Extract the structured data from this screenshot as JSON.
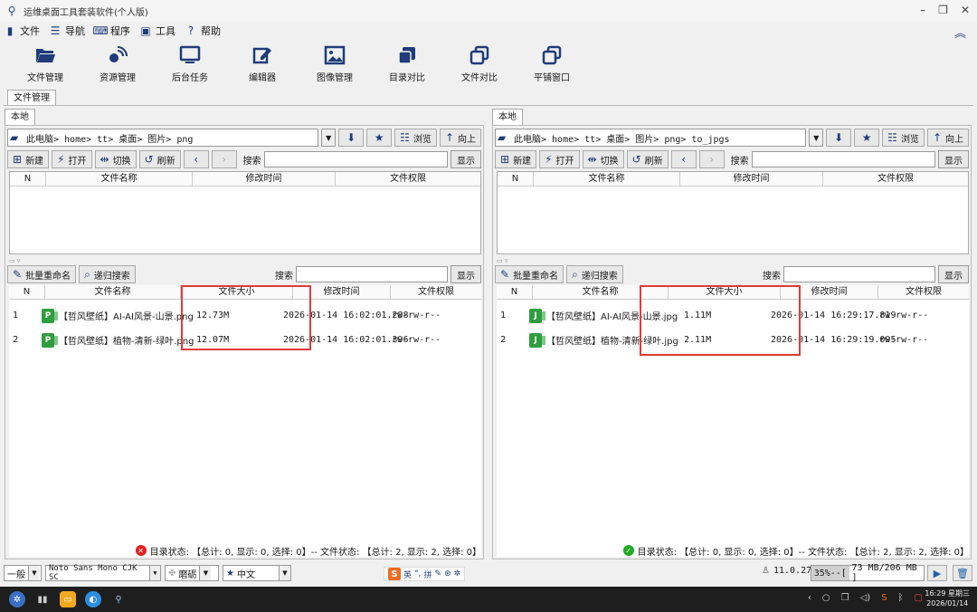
{
  "window": {
    "title": "运维桌面工具套装软件(个人版)"
  },
  "menu": [
    {
      "label": "文件",
      "icon": "file-icon"
    },
    {
      "label": "导航",
      "icon": "list-icon"
    },
    {
      "label": "程序",
      "icon": "keyboard-icon"
    },
    {
      "label": "工具",
      "icon": "toolbox-icon"
    },
    {
      "label": "帮助",
      "icon": "help-icon"
    }
  ],
  "toolbar": [
    {
      "label": "文件管理",
      "icon": "folder-open-icon"
    },
    {
      "label": "资源管理",
      "icon": "satellite-icon"
    },
    {
      "label": "后台任务",
      "icon": "monitor-icon"
    },
    {
      "label": "编辑器",
      "icon": "edit-icon"
    },
    {
      "label": "图像管理",
      "icon": "image-icon"
    },
    {
      "label": "目录对比",
      "icon": "copy-icon"
    },
    {
      "label": "文件对比",
      "icon": "compare-icon"
    },
    {
      "label": "平铺窗口",
      "icon": "windows-icon"
    }
  ],
  "main_tab": "文件管理",
  "panels": {
    "left": {
      "tab": "本地",
      "path": "此电脑> home> tt> 桌面> 图片> png",
      "browse": "浏览",
      "up": "向上",
      "actions": {
        "new": "新建",
        "open": "打开",
        "switch": "切换",
        "refresh": "刷新"
      },
      "search_label": "搜索",
      "show_button": "显示",
      "dir_headers": [
        "N",
        "文件名称",
        "修改时间",
        "文件权限"
      ],
      "batch_rename": "批量重命名",
      "recursive_search": "递归搜索",
      "file_headers": [
        "N",
        "文件名称",
        "文件大小",
        "修改时间",
        "文件权限"
      ],
      "files": [
        {
          "n": "1",
          "name": "【哲风壁纸】AI-AI风景-山景.png",
          "size": "12.73M",
          "mtime": "2026-01-14 16:02:01.288",
          "perm": "rw-rw-r--",
          "type": "P"
        },
        {
          "n": "2",
          "name": "【哲风壁纸】植物-清新-绿叶.png",
          "size": "12.07M",
          "mtime": "2026-01-14 16:02:01.396",
          "perm": "rw-rw-r--",
          "type": "P"
        }
      ],
      "status": "目录状态: 【总计: 0, 显示: 0, 选择: 0】-- 文件状态: 【总计: 2, 显示: 2, 选择: 0】",
      "status_color": "#e02020"
    },
    "right": {
      "tab": "本地",
      "path": "此电脑> home> tt> 桌面> 图片> png> to_jpgs",
      "browse": "浏览",
      "up": "向上",
      "actions": {
        "new": "新建",
        "open": "打开",
        "switch": "切换",
        "refresh": "刷新"
      },
      "search_label": "搜索",
      "show_button": "显示",
      "dir_headers": [
        "N",
        "文件名称",
        "修改时间",
        "文件权限"
      ],
      "batch_rename": "批量重命名",
      "recursive_search": "递归搜索",
      "file_headers": [
        "N",
        "文件名称",
        "文件大小",
        "修改时间",
        "文件权限"
      ],
      "files": [
        {
          "n": "1",
          "name": "【哲风壁纸】AI-AI风景-山景.jpg",
          "size": "1.11M",
          "mtime": "2026-01-14 16:29:17.819",
          "perm": "rw-rw-r--",
          "type": "J"
        },
        {
          "n": "2",
          "name": "【哲风壁纸】植物-清新-绿叶.jpg",
          "size": "2.11M",
          "mtime": "2026-01-14 16:29:19.095",
          "perm": "rw-rw-r--",
          "type": "J"
        }
      ],
      "status": "目录状态: 【总计: 0, 显示: 0, 选择: 0】-- 文件状态: 【总计: 2, 显示: 2, 选择: 0】",
      "status_color": "#22aa22"
    }
  },
  "bottom": {
    "mode": "一般",
    "font": "Noto Sans Mono CJK SC",
    "theme": "磨砺",
    "language": "中文",
    "ime_text": "英",
    "ime_pin": "拼",
    "version": "11.0.27",
    "memory_percent": "35%",
    "memory_text": "73 MB/206 MB ]",
    "memory_prefix": "--["
  },
  "taskbar": {
    "time": "16:29 星期三",
    "date": "2026/01/14"
  },
  "colors": {
    "accent": "#1f3c7a",
    "highlight_box": "#e23a3a"
  }
}
